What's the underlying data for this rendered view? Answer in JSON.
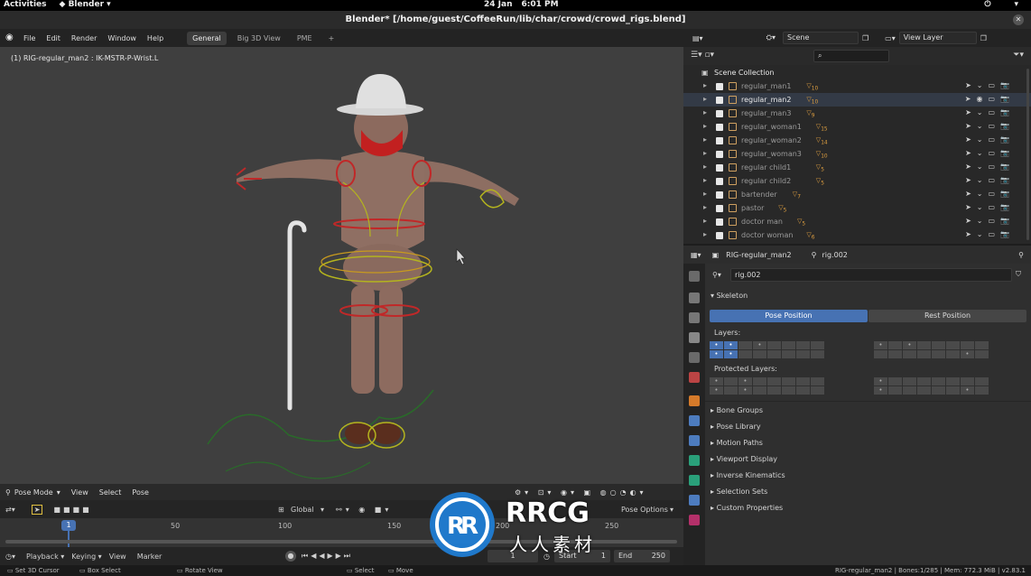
{
  "gnome": {
    "activities": "Activities",
    "app": "Blender ▾",
    "date": "24 Jan",
    "time": "6:01 PM"
  },
  "window": {
    "title": "Blender* [/home/guest/CoffeeRun/lib/char/crowd/crowd_rigs.blend]"
  },
  "topmenu": {
    "items": [
      "File",
      "Edit",
      "Render",
      "Window",
      "Help"
    ],
    "tabs": [
      "General",
      "Big 3D View",
      "PME"
    ],
    "add": "+"
  },
  "outliner_header": {
    "scene": "Scene",
    "view_layer": "View Layer"
  },
  "viewport": {
    "info": "(1) RIG-regular_man2 : IK-MSTR-P-Wrist.L"
  },
  "outliner": {
    "collection": "Scene Collection",
    "items": [
      {
        "name": "regular_man1",
        "badge": "10",
        "sel": false
      },
      {
        "name": "regular_man2",
        "badge": "10",
        "sel": true
      },
      {
        "name": "regular_man3",
        "badge": "9",
        "sel": false
      },
      {
        "name": "regular_woman1",
        "badge": "15",
        "sel": false
      },
      {
        "name": "regular_woman2",
        "badge": "14",
        "sel": false
      },
      {
        "name": "regular_woman3",
        "badge": "10",
        "sel": false
      },
      {
        "name": "regular child1",
        "badge": "5",
        "sel": false
      },
      {
        "name": "regular child2",
        "badge": "5",
        "sel": false
      },
      {
        "name": "bartender",
        "badge": "7",
        "sel": false
      },
      {
        "name": "pastor",
        "badge": "5",
        "sel": false
      },
      {
        "name": "doctor man",
        "badge": "5",
        "sel": false
      },
      {
        "name": "doctor woman",
        "badge": "6",
        "sel": false
      }
    ]
  },
  "props_header": {
    "object": "RIG-regular_man2",
    "armature": "rig.002"
  },
  "props": {
    "datablock": "rig.002",
    "skeleton": "Skeleton",
    "pose_position": "Pose Position",
    "rest_position": "Rest Position",
    "layers": "Layers:",
    "protected_layers": "Protected Layers:",
    "panels": [
      "Bone Groups",
      "Pose Library",
      "Motion Paths",
      "Viewport Display",
      "Inverse Kinematics",
      "Selection Sets",
      "Custom Properties"
    ]
  },
  "vp_header": {
    "mode": "Pose Mode",
    "menus": [
      "View",
      "Select",
      "Pose"
    ],
    "pose_options": "Pose Options"
  },
  "tl_toolbar": {
    "orientation": "Global"
  },
  "timeline": {
    "ticks": [
      "0",
      "50",
      "100",
      "150",
      "200",
      "250"
    ],
    "current_frame": "1"
  },
  "tl_bottom": {
    "menus": [
      "Playback",
      "Keying",
      "View",
      "Marker"
    ],
    "frame": "1",
    "start_label": "Start",
    "start": "1",
    "end_label": "End",
    "end": "250"
  },
  "status": {
    "left": [
      "Set 3D Cursor",
      "Box Select",
      "Rotate View",
      "Select",
      "Move"
    ],
    "right": "RIG-regular_man2 | Bones:1/285 | Mem: 772.3 MiB | v2.83.1"
  },
  "watermark": {
    "brand": "RRCG",
    "sub": "人人素材"
  }
}
